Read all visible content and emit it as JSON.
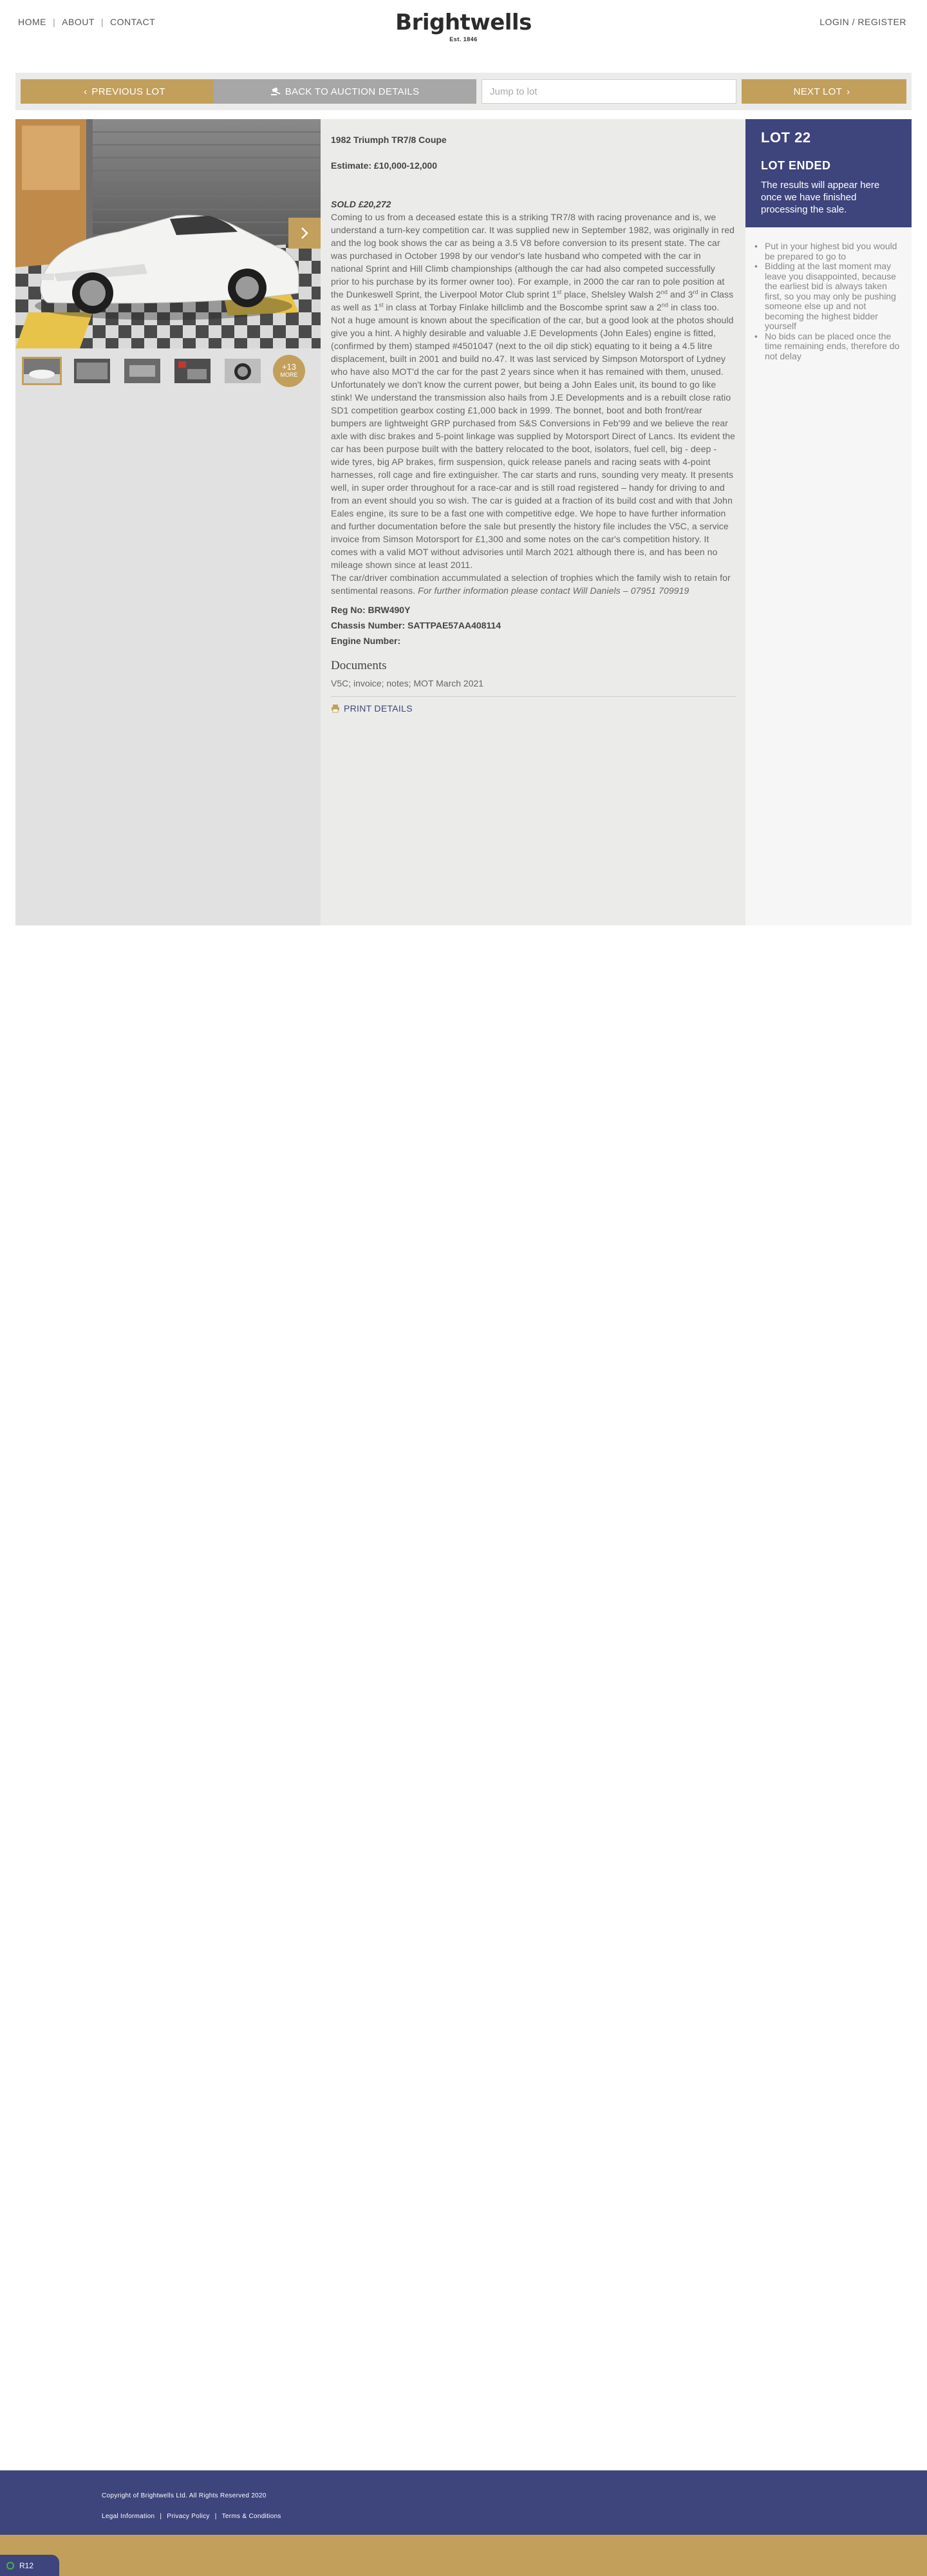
{
  "header": {
    "nav": [
      "HOME",
      "ABOUT",
      "CONTACT"
    ],
    "logo": "Brightwells",
    "logo_est": "Est. 1846",
    "login": "LOGIN / REGISTER"
  },
  "lotbar": {
    "previous": "PREVIOUS LOT",
    "back": "BACK TO AUCTION DETAILS",
    "jump_placeholder": "Jump to lot",
    "next": "NEXT LOT"
  },
  "gallery": {
    "more_count": "+13",
    "more_label": "MORE"
  },
  "lot": {
    "title": "1982 Triumph TR7/8 Coupe",
    "estimate": "Estimate: £10,000-12,000",
    "sold": "SOLD £20,272",
    "description_1": "Coming to us from a deceased estate this is a striking TR7/8 with racing provenance and is, we understand a turn-key competition car. It was supplied new in September 1982, was originally in red and the log book shows the car as being a 3.5 V8 before conversion to its present state. The car was purchased in October 1998 by our vendor's late husband who competed with the car in national Sprint and Hill Climb championships (although the car had also competed successfully prior to his purchase by its former owner too). For example, in 2000 the car ran to pole position at the Dunkeswell Sprint, the Liverpool Motor Club sprint 1",
    "sup_st_1": "st",
    "description_2": " place, Shelsley Walsh 2",
    "sup_nd_1": "nd",
    "description_3": " and 3",
    "sup_rd_1": "rd",
    "description_4": " in Class as well as 1",
    "sup_st_2": "st",
    "description_5": " in class at Torbay Finlake hillclimb and the Boscombe sprint saw a 2",
    "sup_nd_2": "nd",
    "description_6": " in class too. Not a huge amount is known about the specification of the car, but a good look at the photos should give you a hint. A highly desirable and valuable J.E Developments (John Eales) engine is fitted, (confirmed by them) stamped #4501047 (next to the oil dip stick) equating to it being a 4.5 litre displacement, built in 2001 and build no.47. It was last serviced by Simpson Motorsport of Lydney who have also MOT'd the car for the past 2 years since when it has remained with them, unused. Unfortunately we don't know the current power, but being a John Eales unit, its bound to go like stink! We understand the transmission also hails from J.E Developments and is a rebuilt close ratio SD1 competition gearbox costing £1,000 back in 1999. The bonnet, boot and both front/rear bumpers are lightweight GRP purchased from S&S Conversions in Feb'99 and we believe the rear axle with disc brakes and 5-point linkage was supplied by Motorsport Direct of Lancs. Its evident the car has been purpose built with the battery relocated to the boot, isolators, fuel cell, big - deep - wide tyres, big AP brakes, firm suspension, quick release panels and racing seats with 4-point harnesses, roll cage and fire extinguisher. The car starts and runs, sounding very meaty. It presents well, in super order throughout for a race-car and is still road registered – handy for driving to and from an event should you so wish. The car is guided at a fraction of its build cost and with that John Eales engine, its sure to be a fast one with competitive edge. We hope to have further information and further documentation before the sale but presently the history file includes the V5C, a service invoice from Simson Motorsport for £1,300 and some notes on the car's competition history. It comes with a valid MOT without advisories until March 2021 although there is, and has been no mileage shown since at least 2011.",
    "description_para2": "The car/driver combination accummulated a selection of trophies which the family wish to retain for sentimental reasons. ",
    "description_italic": "For further information please contact Will Daniels – 07951 709919",
    "reg": "Reg No: BRW490Y",
    "chassis": "Chassis Number: SATTPAE57AA408114",
    "engine": "Engine Number:",
    "documents_title": "Documents",
    "documents_list": "V5C; invoice; notes; MOT March 2021",
    "print": "PRINT DETAILS"
  },
  "status": {
    "lot_number": "LOT 22",
    "ended": "LOT ENDED",
    "message": "The results will appear here once we have finished processing the sale.",
    "tips": [
      "Put in your highest bid you would be prepared to go to",
      "Bidding at the last moment may leave you disappointed, because the earliest bid is always taken first, so you may only be pushing someone else up and not becoming the highest bidder yourself",
      "No bids can be placed once the time remaining ends, therefore do not delay"
    ]
  },
  "footer": {
    "copyright": "Copyright of Brightwells Ltd. All Rights Reserved 2020",
    "links": [
      "Legal Information",
      "Privacy Policy",
      "Terms & Conditions"
    ],
    "tag": "R12"
  },
  "colors": {
    "gold": "#c2a05b",
    "navy": "#3e447c",
    "grey_button": "#a7a7a7"
  }
}
